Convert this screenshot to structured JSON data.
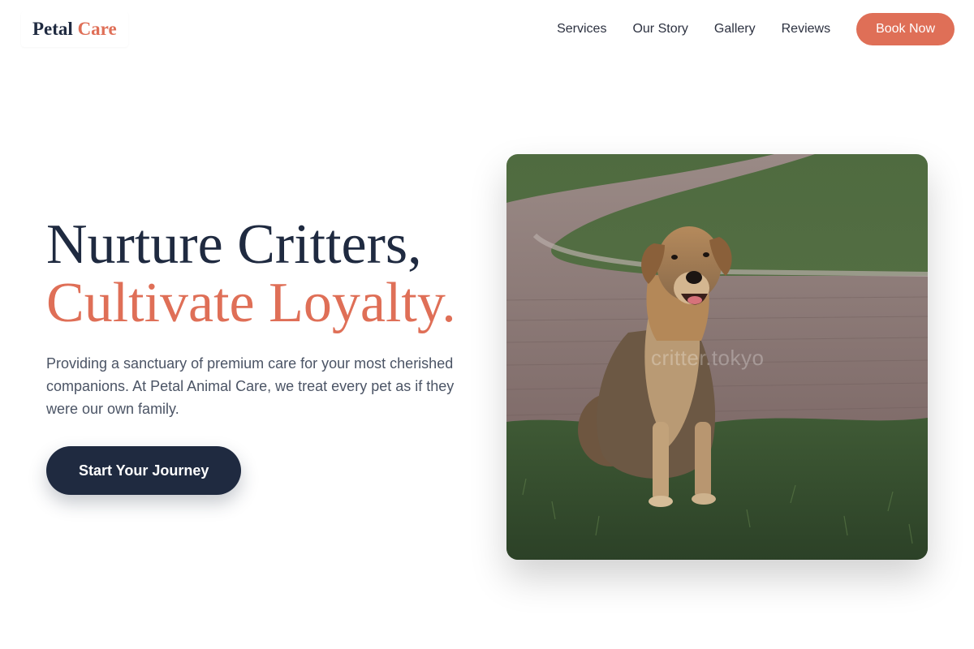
{
  "brand": {
    "name_part1": "Petal",
    "name_part2": "Care",
    "accent_color": "#df6f57",
    "dark_color": "#1f2a40"
  },
  "nav": {
    "links": [
      {
        "label": "Services"
      },
      {
        "label": "Our Story"
      },
      {
        "label": "Gallery"
      },
      {
        "label": "Reviews"
      }
    ],
    "cta_label": "Book Now"
  },
  "hero": {
    "headline_line1": "Nurture Critters,",
    "headline_line2": "Cultivate Loyalty.",
    "subtext": "Providing a sanctuary of premium care for your most cherished companions. At Petal Animal Care, we treat every pet as if they were our own family.",
    "cta_label": "Start Your Journey",
    "image": {
      "subject": "dog-sitting-on-grass-photo",
      "watermark": "critter.tokyo"
    }
  }
}
